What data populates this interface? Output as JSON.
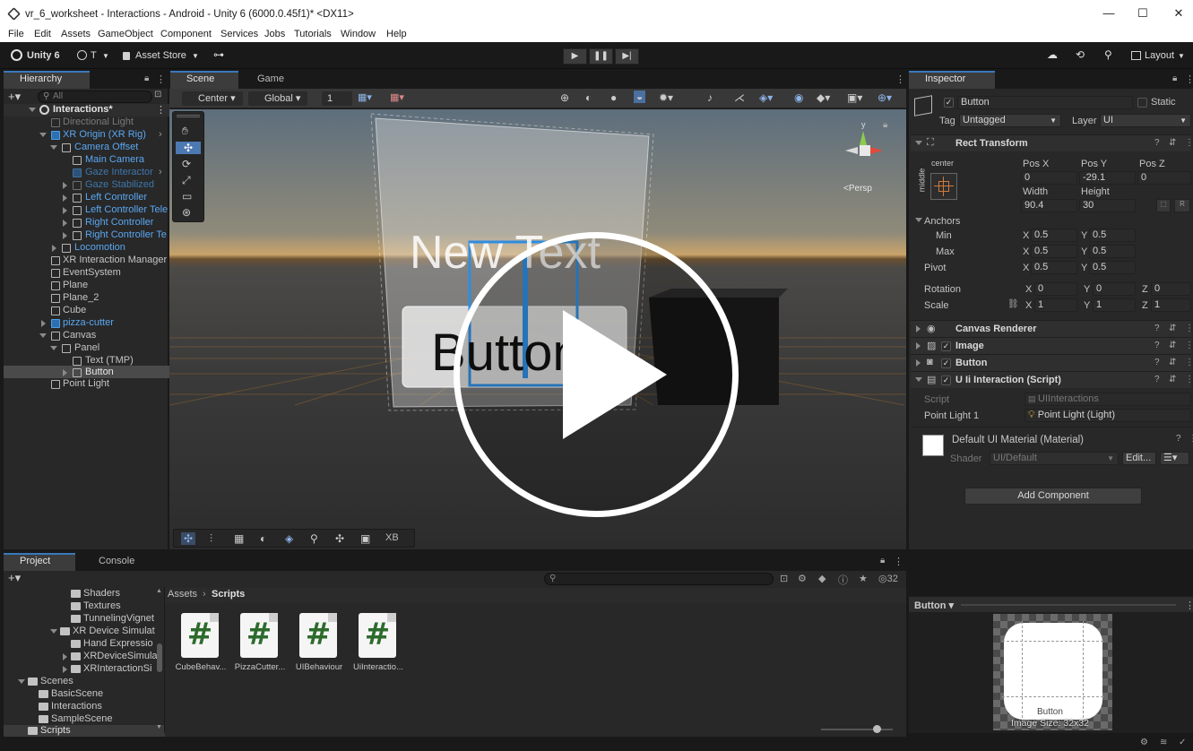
{
  "window": {
    "title": "vr_6_worksheet - Interactions - Android - Unity 6 (6000.0.45f1)* <DX11>",
    "controls": [
      "—",
      "☐",
      "✕"
    ]
  },
  "menu": [
    "File",
    "Edit",
    "Assets",
    "GameObject",
    "Component",
    "Services",
    "Jobs",
    "Tutorials",
    "Window",
    "Help"
  ],
  "toolbar": {
    "unity_label": "Unity 6",
    "account_label": "T",
    "asset_store_label": "Asset Store",
    "layout_label": "Layout"
  },
  "hierarchy": {
    "tab": "Hierarchy",
    "search_placeholder": "All",
    "scene": "Interactions*",
    "items": [
      {
        "label": "Directional Light"
      },
      {
        "label": "XR Origin (XR Rig)"
      },
      {
        "label": "Camera Offset"
      },
      {
        "label": "Main Camera"
      },
      {
        "label": "Gaze Interactor"
      },
      {
        "label": "Gaze Stabilized"
      },
      {
        "label": "Left Controller"
      },
      {
        "label": "Left Controller Tele"
      },
      {
        "label": "Right Controller"
      },
      {
        "label": "Right Controller Te"
      },
      {
        "label": "Locomotion"
      },
      {
        "label": "XR Interaction Manager"
      },
      {
        "label": "EventSystem"
      },
      {
        "label": "Plane"
      },
      {
        "label": "Plane_2"
      },
      {
        "label": "Cube"
      },
      {
        "label": "pizza-cutter"
      },
      {
        "label": "Canvas"
      },
      {
        "label": "Panel"
      },
      {
        "label": "Text (TMP)"
      },
      {
        "label": "Button"
      },
      {
        "label": "Point Light"
      }
    ]
  },
  "scene_view": {
    "tabs": [
      "Scene",
      "Game"
    ],
    "pivot_mode": "Center",
    "space_mode": "Global",
    "layer_value": "1",
    "persp_label": "<Persp",
    "world_text": "New Text",
    "button_text": "Button",
    "overlay_xb": "XB"
  },
  "inspector": {
    "tab": "Inspector",
    "object_name": "Button",
    "static_label": "Static",
    "tag_label": "Tag",
    "tag_value": "Untagged",
    "layer_label": "Layer",
    "layer_value": "UI",
    "rect_transform": {
      "title": "Rect Transform",
      "anchor_preset_h": "center",
      "anchor_preset_v": "middle",
      "pos_x_label": "Pos X",
      "pos_x": "0",
      "pos_y_label": "Pos Y",
      "pos_y": "-29.1",
      "pos_z_label": "Pos Z",
      "pos_z": "0",
      "width_label": "Width",
      "width": "90.4",
      "height_label": "Height",
      "height": "30",
      "anchors_label": "Anchors",
      "min_label": "Min",
      "min_x": "0.5",
      "min_y": "0.5",
      "max_label": "Max",
      "max_x": "0.5",
      "max_y": "0.5",
      "pivot_label": "Pivot",
      "pivot_x": "0.5",
      "pivot_y": "0.5",
      "rotation_label": "Rotation",
      "rot_x": "0",
      "rot_y": "0",
      "rot_z": "0",
      "scale_label": "Scale",
      "scale_x": "1",
      "scale_y": "1",
      "scale_z": "1"
    },
    "components": [
      "Canvas Renderer",
      "Image",
      "Button",
      "U Ii Interaction (Script)"
    ],
    "script_label": "Script",
    "script_value": "UIInteractions",
    "point_light_label": "Point Light 1",
    "point_light_value": "Point Light (Light)",
    "material_name": "Default UI Material (Material)",
    "shader_label": "Shader",
    "shader_value": "UI/Default",
    "edit_label": "Edit...",
    "add_component": "Add Component",
    "preview_title": "Button",
    "preview_name": "Button",
    "preview_size": "Image Size: 32x32"
  },
  "project": {
    "tabs": [
      "Project",
      "Console"
    ],
    "breadcrumb": [
      "Assets",
      "Scripts"
    ],
    "count": "32",
    "tree": [
      {
        "label": "Shaders"
      },
      {
        "label": "Textures"
      },
      {
        "label": "TunnelingVignet"
      },
      {
        "label": "XR Device Simulat"
      },
      {
        "label": "Hand Expressio"
      },
      {
        "label": "XRDeviceSimula"
      },
      {
        "label": "XRInteractionSi"
      },
      {
        "label": "Scenes"
      },
      {
        "label": "BasicScene"
      },
      {
        "label": "Interactions"
      },
      {
        "label": "SampleScene"
      },
      {
        "label": "Scripts"
      }
    ],
    "assets": [
      "CubeBehav...",
      "PizzaCutter...",
      "UIBehaviour",
      "UiInteractio..."
    ]
  },
  "colors": {
    "accent_blue": "#3a79bb",
    "hierarchy_blue": "#5aa7f2",
    "panel_bg": "#282828",
    "chrome_bg": "#191919"
  }
}
